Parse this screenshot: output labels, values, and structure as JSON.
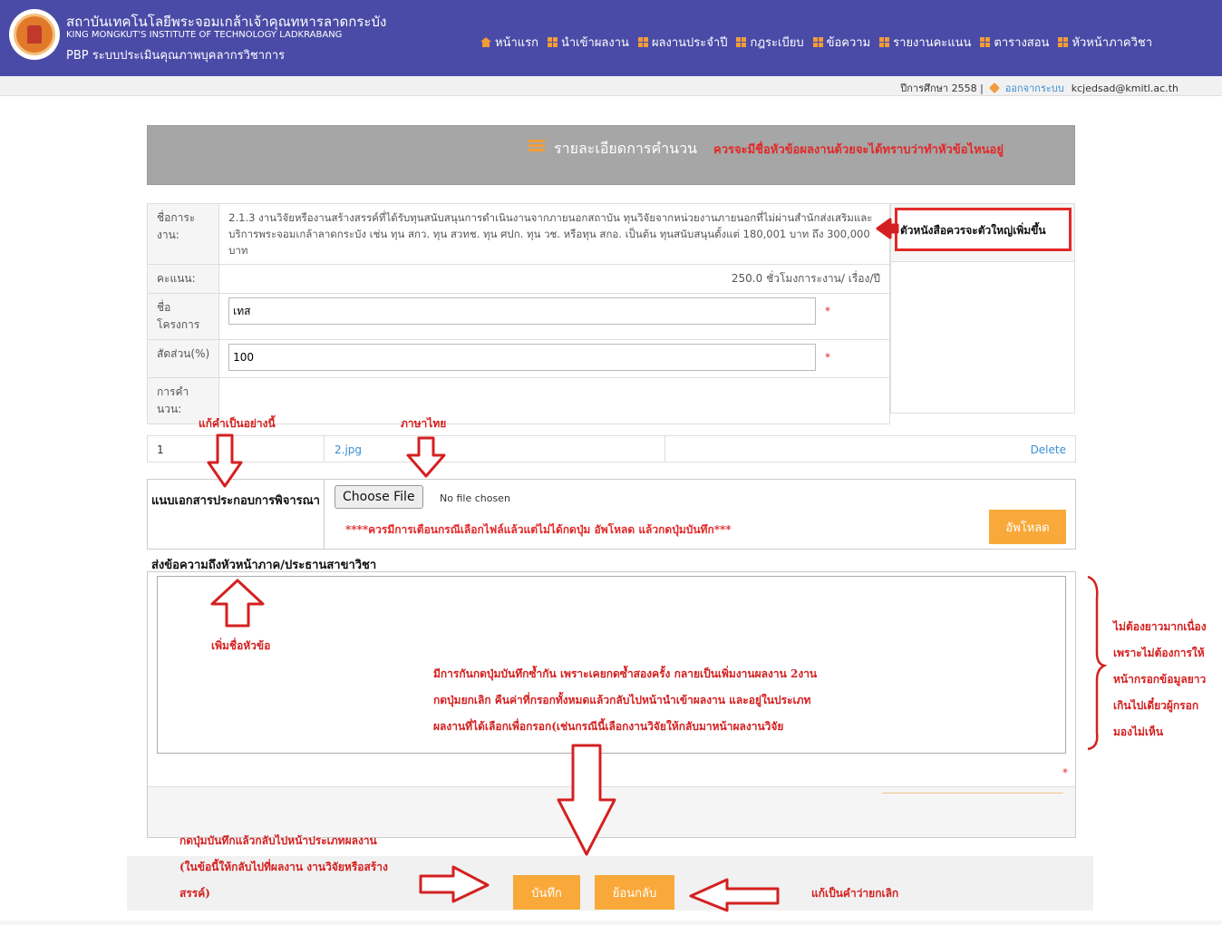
{
  "header": {
    "institute_th": "สถาบันเทคโนโลยีพระจอมเกล้าเจ้าคุณทหารลาดกระบัง",
    "institute_en": "KING MONGKUT'S INSTITUTE OF TECHNOLOGY LADKRABANG",
    "system_name": "PBP ระบบประเมินคุณภาพบุคลากรวิชาการ",
    "nav": [
      {
        "label": "หน้าแรก",
        "icon": "home-icon"
      },
      {
        "label": "นำเข้าผลงาน",
        "icon": "grid-icon"
      },
      {
        "label": "ผลงานประจำปี",
        "icon": "grid-icon"
      },
      {
        "label": "กฎระเบียบ",
        "icon": "grid-icon"
      },
      {
        "label": "ข้อความ",
        "icon": "grid-icon"
      },
      {
        "label": "รายงานคะแนน",
        "icon": "grid-icon"
      },
      {
        "label": "ตารางสอน",
        "icon": "grid-icon"
      },
      {
        "label": "หัวหน้าภาควิชา",
        "icon": "grid-icon"
      }
    ]
  },
  "subbar": {
    "year": "ปีการศึกษา 2558 |",
    "logout": "ออกจากระบบ",
    "email": "kcjedsad@kmitl.ac.th"
  },
  "panel": {
    "title": "รายละเอียดการคำนวน"
  },
  "form": {
    "work_label": "ชื่อการะงาน:",
    "work_value": "2.1.3 งานวิจัยหรืองานสร้างสรรค์ที่ได้รับทุนสนับสนุนการดำเนินงานจากภายนอกสถาบัน ทุนวิจัยจากหน่วยงานภายนอกที่ไม่ผ่านสำนักส่งเสริมและบริการพระจอมเกล้าลาดกระบัง เช่น ทุน สกว. ทุน สวทช. ทุน ศปก. ทุน วช. หรือทุน สกอ. เป็นต้น ทุนสนับสนุนตั้งแต่ 180,001 บาท ถึง 300,000 บาท",
    "score_label": "คะแนน:",
    "score_value": "250.0 ชั่วโมงการะงาน/ เรื่อง/ปี",
    "project_label": "ชื่อโครงการ",
    "project_value": "เทส",
    "ratio_label": "สัดส่วน(%)",
    "ratio_value": "100",
    "calc_label": "การคำนวน:",
    "required_mark": "*"
  },
  "file_list": {
    "row_no": "1",
    "file_name": "2.jpg",
    "delete": "Delete"
  },
  "attach": {
    "label": "แนบเอกสารประกอบการพิจารณา",
    "choose_button": "Choose File",
    "no_file": "No file chosen",
    "upload_button": "อัพโหลด"
  },
  "message": {
    "label": "ส่งข้อความถึงหัวหน้าภาค/ประธานสาขาวิชา",
    "required_mark": "*"
  },
  "footer": {
    "save_button": "บันทึก",
    "back_button": "ย้อนกลับ"
  },
  "annotations": {
    "title_note": "ควรจะมีชื่อหัวข้อผลงานด้วยจะได้ทราบว่าทำหัวข้อไหนอยู่",
    "font_note": "ตัวหนังสือควรจะตัวใหญ่เพิ่มขึ้น",
    "rename_note": "แก้คำเป็นอย่างนี้",
    "thai_note": "ภาษาไทย",
    "upload_warning": "****ควรมีการเตือนกรณีเลือกไฟล์แล้วแต่ไม่ได้กดปุ่ม อัพโหลด แล้วกดปุ่มบันทึก***",
    "add_title_note": "เพิ่มชื่อหัวข้อ",
    "double_save_line1": "มีการกันกดปุ่มบันทึกซ้ำกัน เพราะเคยกดซ้ำสองครั้ง กลายเป็นเพิ่มงานผลงาน 2งาน",
    "double_save_line2": "กดปุ่มยกเลิก   คืนค่าที่กรอกทั้งหมดแล้วกลับไปหน้านำเข้าผลงาน และอยู่ในประเภท",
    "double_save_line3": "ผลงานที่ได้เลือกเพื่อกรอก(เช่นกรณีนี้เลือกงานวิจัยให้กลับมาหน้าผลงานวิจัย",
    "side_line1": "ไม่ต้องยาวมากเนื่อง",
    "side_line2": "เพราะไม่ต้องการให้",
    "side_line3": "หน้ากรอกข้อมูลยาว",
    "side_line4": "เกินไปเดี๋ยวผู้กรอก",
    "side_line5": "มองไม่เห็น",
    "save_note_line1": "กดปุ่มบันทึกแล้วกลับไปหน้าประเภทผลงาน",
    "save_note_line2": "(ในข้อนี้ให้กลับไปที่ผลงาน งานวิจัยหรือสร้าง",
    "save_note_line3": "สรรค์)",
    "cancel_note": "แก้เป็นคำว่ายกเลิก",
    "color": "#e32828"
  },
  "colors": {
    "header_bg": "#4a4ba7",
    "accent": "#f8a93a",
    "panel_gray": "#a6a6a6"
  }
}
